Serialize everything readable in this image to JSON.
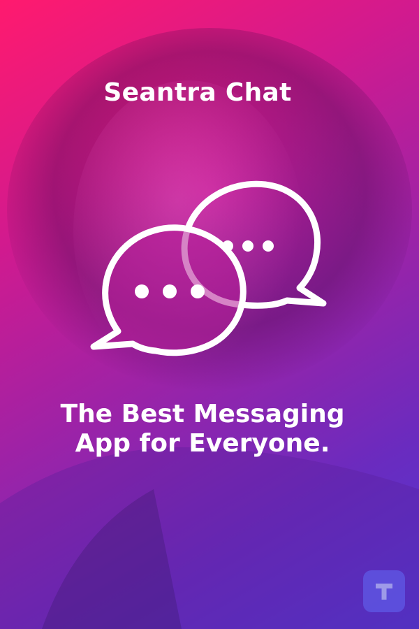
{
  "poster": {
    "brand_name": "Seantra Chat",
    "tagline_line1": "The Best Messaging",
    "tagline_line2": "App for Everyone.",
    "logo": {
      "icon": "chat-bubbles-icon",
      "bubble_dots": 3
    },
    "watermark": {
      "icon": "t-letter-icon",
      "letter": "T"
    },
    "colors": {
      "gradient_start": "#ff1a6e",
      "gradient_mid": "#9a23a8",
      "gradient_end": "#4e3ad6",
      "foreground": "#ffffff",
      "watermark_bg": "#5f5ae6"
    }
  }
}
